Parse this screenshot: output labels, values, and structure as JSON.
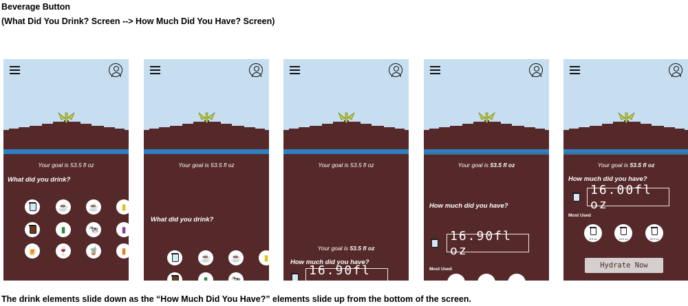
{
  "header": {
    "title": "Beverage Button",
    "subtitle": "(What Did You Drink? Screen --> How Much Did You Have? Screen)"
  },
  "caption": "The drink elements slide down as the “How Much Did You Have?” elements slide up from the bottom of the screen.",
  "goal_prefix": "Your goal is",
  "goal_text": "Your goal is 53.5 fl oz",
  "goal_value": "53.5 fl oz",
  "what_label": "What did you drink?",
  "how_much_label": "How much did you have?",
  "most_used_label": "Most Used",
  "frame3_amount": "16.90fl oz",
  "frame4_amount": "16.90fl oz",
  "frame5_amount": "16.00fl oz",
  "most_used_sizes": [
    "8 fl oz",
    "16 fl oz",
    "32 fl oz"
  ],
  "hydrate_label": "Hydrate Now",
  "colors": {
    "soil": "#55292a",
    "sky": "#c6def0",
    "water": "#2f7fc2",
    "sprout": "#b9c73a"
  }
}
